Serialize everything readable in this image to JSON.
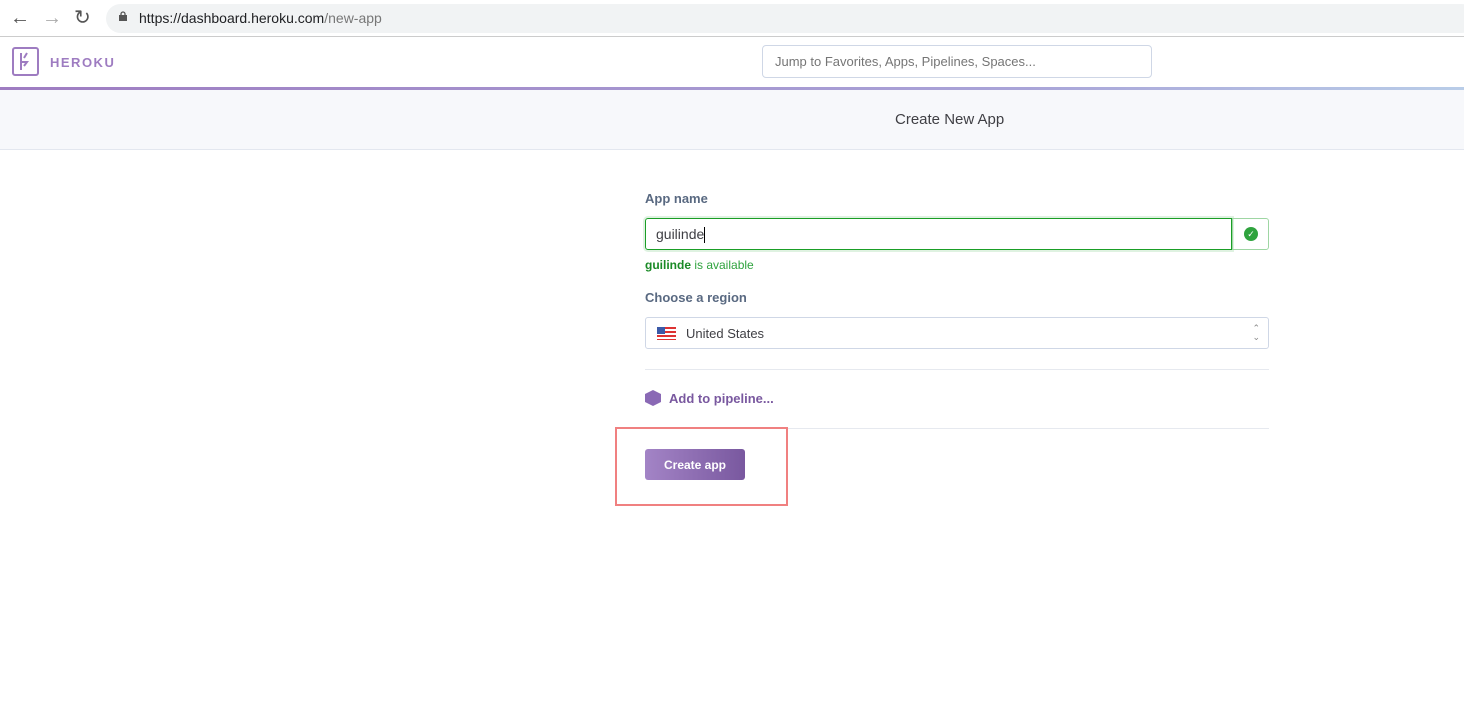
{
  "browser": {
    "url_host": "https://dashboard.heroku.com",
    "url_path": "/new-app"
  },
  "header": {
    "brand": "HEROKU",
    "search_placeholder": "Jump to Favorites, Apps, Pipelines, Spaces..."
  },
  "page": {
    "title": "Create New App"
  },
  "form": {
    "app_name_label": "App name",
    "app_name_value": "guilinde",
    "availability_name": "guilinde",
    "availability_text": " is available",
    "region_label": "Choose a region",
    "region_value": "United States",
    "pipeline_link": "Add to pipeline...",
    "create_button": "Create app"
  },
  "colors": {
    "accent": "#79589f",
    "success": "#2fa33e",
    "highlight": "#f08080"
  }
}
